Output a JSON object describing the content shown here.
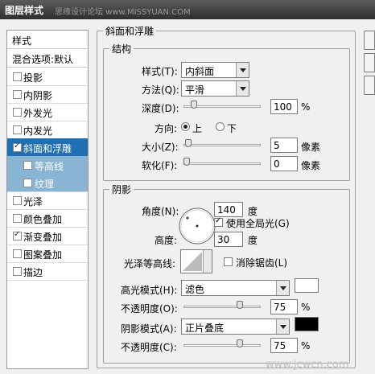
{
  "titlebar": {
    "title": "图层样式",
    "watermark": "思缘设计论坛 www.MISSYUAN.COM"
  },
  "sidebar": {
    "header": "样式",
    "blend": "混合选项:默认",
    "items": [
      {
        "label": "投影",
        "checked": false
      },
      {
        "label": "内阴影",
        "checked": false
      },
      {
        "label": "外发光",
        "checked": false
      },
      {
        "label": "内发光",
        "checked": false
      },
      {
        "label": "斜面和浮雕",
        "checked": true
      },
      {
        "label": "等高线",
        "checked": false
      },
      {
        "label": "纹理",
        "checked": false
      },
      {
        "label": "光泽",
        "checked": false
      },
      {
        "label": "颜色叠加",
        "checked": false
      },
      {
        "label": "渐变叠加",
        "checked": true
      },
      {
        "label": "图案叠加",
        "checked": false
      },
      {
        "label": "描边",
        "checked": false
      }
    ]
  },
  "bevel": {
    "title": "斜面和浮雕",
    "structure": {
      "title": "结构",
      "style_label": "样式(T):",
      "style_value": "内斜面",
      "method_label": "方法(Q):",
      "method_value": "平滑",
      "depth_label": "深度(D):",
      "depth_value": "100",
      "depth_unit": "%",
      "direction_label": "方向:",
      "dir_up": "上",
      "dir_down": "下",
      "size_label": "大小(Z):",
      "size_value": "5",
      "size_unit": "像素",
      "soften_label": "软化(F):",
      "soften_value": "0",
      "soften_unit": "像素"
    },
    "shading": {
      "title": "阴影",
      "angle_label": "角度(N):",
      "angle_value": "140",
      "angle_unit": "度",
      "global_light": "使用全局光(G)",
      "altitude_label": "高度:",
      "altitude_value": "30",
      "altitude_unit": "度",
      "gloss_label": "光泽等高线:",
      "anti_alias": "消除锯齿(L)",
      "highlight_label": "高光模式(H):",
      "highlight_mode": "滤色",
      "highlight_color": "#ffffff",
      "hl_opacity_label": "不透明度(O):",
      "hl_opacity_value": "75",
      "hl_opacity_unit": "%",
      "shadow_label": "阴影模式(A):",
      "shadow_mode": "正片叠底",
      "shadow_color": "#000000",
      "sh_opacity_label": "不透明度(C):",
      "sh_opacity_value": "75",
      "sh_opacity_unit": "%"
    }
  },
  "sliders": {
    "depth": 0.1,
    "size": 0.02,
    "soften": 0,
    "hl_opacity": 0.75,
    "sh_opacity": 0.75
  },
  "watermark2": "www.jcwcn.com"
}
